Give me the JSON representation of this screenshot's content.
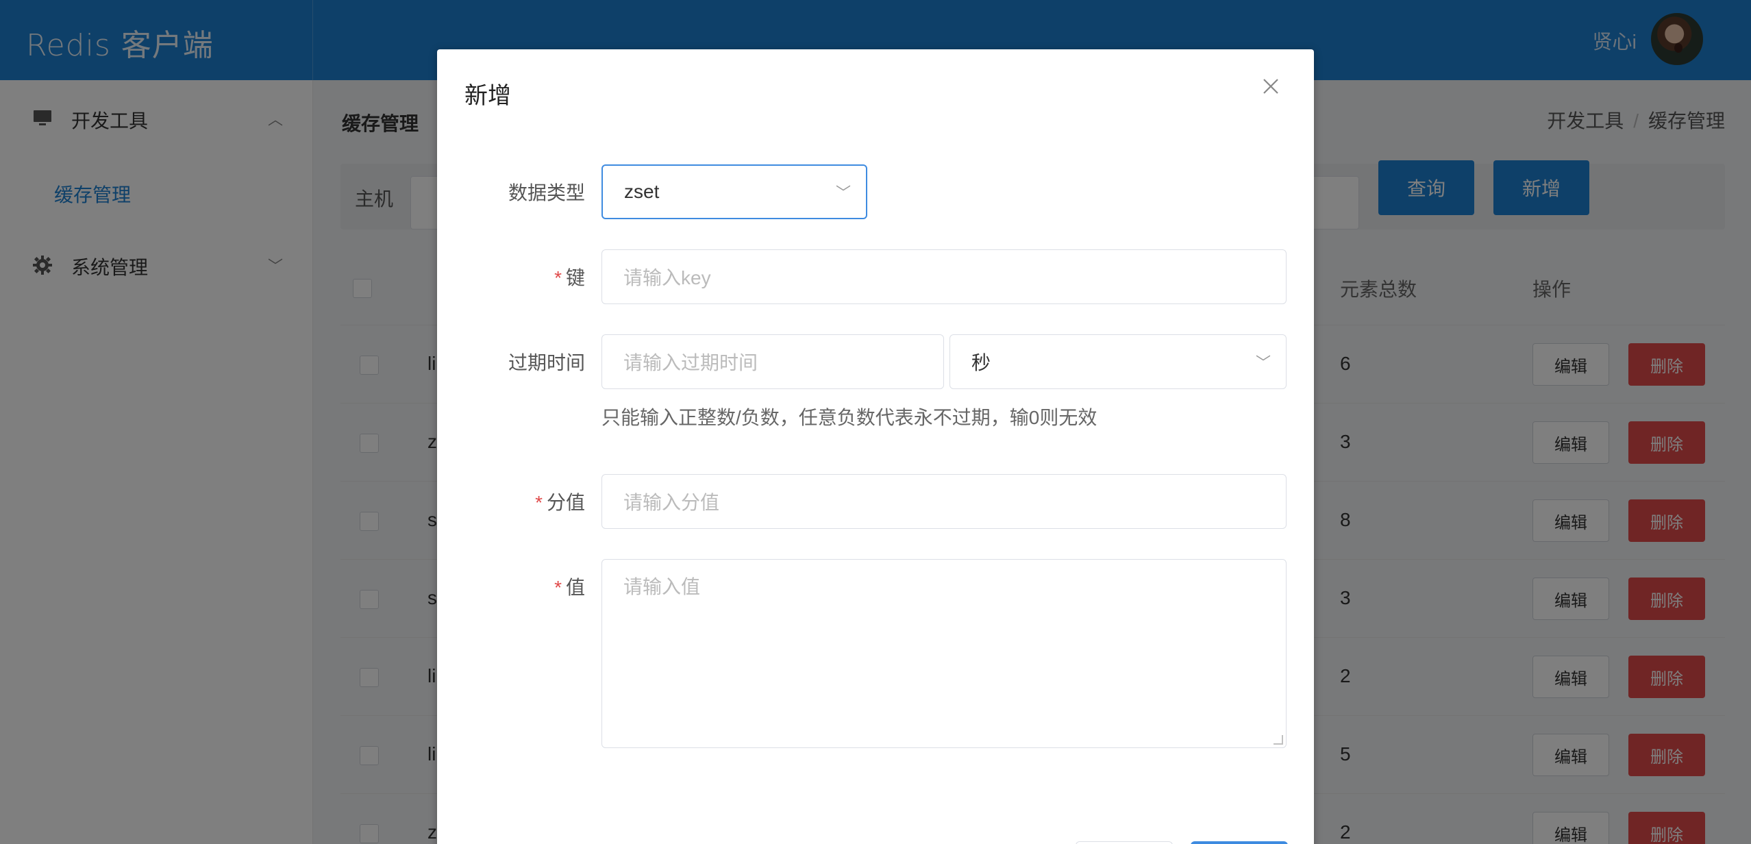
{
  "app": {
    "title": "Redis 客户端",
    "username": "贤心i"
  },
  "sidebar": {
    "groups": [
      {
        "label": "开发工具",
        "icon": "monitor-icon",
        "expanded": true,
        "items": [
          {
            "label": "缓存管理",
            "active": true
          }
        ]
      },
      {
        "label": "系统管理",
        "icon": "gear-icon",
        "expanded": false,
        "items": []
      }
    ]
  },
  "page": {
    "title": "缓存管理",
    "breadcrumb": [
      "开发工具",
      "/",
      "缓存管理"
    ]
  },
  "search": {
    "label": "主机",
    "query_label": "查询",
    "add_label": "新增"
  },
  "table": {
    "headers": {
      "count": "元素总数",
      "actions": "操作"
    },
    "rows": [
      {
        "first": "li",
        "count": "6"
      },
      {
        "first": "z",
        "count": "3"
      },
      {
        "first": "s",
        "count": "8"
      },
      {
        "first": "s",
        "count": "3"
      },
      {
        "first": "li",
        "count": "2"
      },
      {
        "first": "li",
        "count": "5"
      },
      {
        "first": "z",
        "count": "2"
      }
    ],
    "edit_label": "编辑",
    "delete_label": "删除"
  },
  "dialog": {
    "title": "新增",
    "fields": {
      "type": {
        "label": "数据类型",
        "value": "zset"
      },
      "key": {
        "label": "键",
        "placeholder": "请输入key"
      },
      "expire": {
        "label": "过期时间",
        "placeholder": "请输入过期时间",
        "unit": "秒",
        "hint": "只能输入正整数/负数，任意负数代表永不过期，输0则无效"
      },
      "score": {
        "label": "分值",
        "placeholder": "请输入分值"
      },
      "value": {
        "label": "值",
        "placeholder": "请输入值"
      }
    },
    "required_mark": "*"
  },
  "colors": {
    "primary": "#1d80d2",
    "danger": "#e04a4a",
    "focus": "#3e8be0"
  }
}
